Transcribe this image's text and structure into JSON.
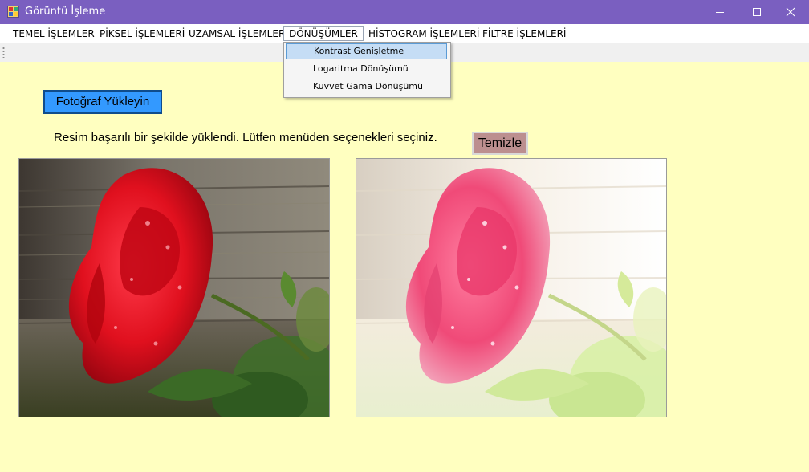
{
  "window": {
    "title": "Görüntü İşleme",
    "controls": {
      "minimize": "minimize-icon",
      "maximize": "maximize-icon",
      "close": "close-icon"
    }
  },
  "menubar": {
    "items": [
      {
        "label": "TEMEL İŞLEMLER"
      },
      {
        "label": "PİKSEL İŞLEMLERİ"
      },
      {
        "label": "UZAMSAL İŞLEMLER"
      },
      {
        "label": "DÖNÜŞÜMLER",
        "open": true
      },
      {
        "label": "HİSTOGRAM İŞLEMLERİ"
      },
      {
        "label": "FİLTRE İŞLEMLERİ"
      }
    ]
  },
  "dropdown": {
    "items": [
      {
        "label": "Kontrast Genişletme",
        "highlighted": true
      },
      {
        "label": "Logaritma Dönüşümü"
      },
      {
        "label": "Kuvvet Gama Dönüşümü"
      }
    ]
  },
  "main": {
    "load_button": "Fotoğraf Yükleyin",
    "status": "Resim başarılı bir şekilde yüklendi. Lütfen menüden seçenekleri seçiniz.",
    "clear_button": "Temizle",
    "original_image": "red rose photo",
    "processed_image": "contrast-stretched red rose photo"
  },
  "colors": {
    "titlebar": "#7a5fc0",
    "form_background": "#ffffc0",
    "load_button": "#3399ff",
    "clear_button": "#bc8f8f",
    "menu_highlight": "#c5ddf5"
  }
}
